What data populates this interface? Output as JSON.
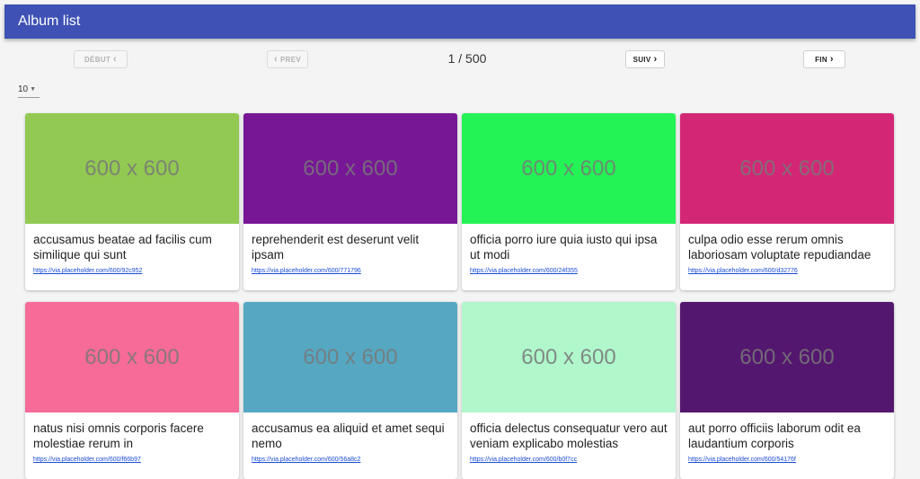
{
  "appbar": {
    "title": "Album list"
  },
  "pagination": {
    "first_label": "DÉBUT",
    "prev_label": "PREV",
    "next_label": "SUIV",
    "last_label": "FIN",
    "indicator": "1 / 500"
  },
  "per_page": {
    "value": "10"
  },
  "albums": [
    {
      "placeholder": "600 x 600",
      "title": "accusamus beatae ad facilis cum similique qui sunt",
      "url": "https://via.placeholder.com/600/92c952",
      "color": "#92c952"
    },
    {
      "placeholder": "600 x 600",
      "title": "reprehenderit est deserunt velit ipsam",
      "url": "https://via.placeholder.com/600/771796",
      "color": "#771796"
    },
    {
      "placeholder": "600 x 600",
      "title": "officia porro iure quia iusto qui ipsa ut modi",
      "url": "https://via.placeholder.com/600/24f355",
      "color": "#24f355"
    },
    {
      "placeholder": "600 x 600",
      "title": "culpa odio esse rerum omnis laboriosam voluptate repudiandae",
      "url": "https://via.placeholder.com/600/d32776",
      "color": "#d32776"
    },
    {
      "placeholder": "600 x 600",
      "title": "natus nisi omnis corporis facere molestiae rerum in",
      "url": "https://via.placeholder.com/600/f66b97",
      "color": "#f66b97"
    },
    {
      "placeholder": "600 x 600",
      "title": "accusamus ea aliquid et amet sequi nemo",
      "url": "https://via.placeholder.com/600/56a8c2",
      "color": "#56a8c2"
    },
    {
      "placeholder": "600 x 600",
      "title": "officia delectus consequatur vero aut veniam explicabo molestias",
      "url": "https://via.placeholder.com/600/b0f7cc",
      "color": "#b0f7cc"
    },
    {
      "placeholder": "600 x 600",
      "title": "aut porro officiis laborum odit ea laudantium corporis",
      "url": "https://via.placeholder.com/600/54176f",
      "color": "#54176f"
    }
  ]
}
